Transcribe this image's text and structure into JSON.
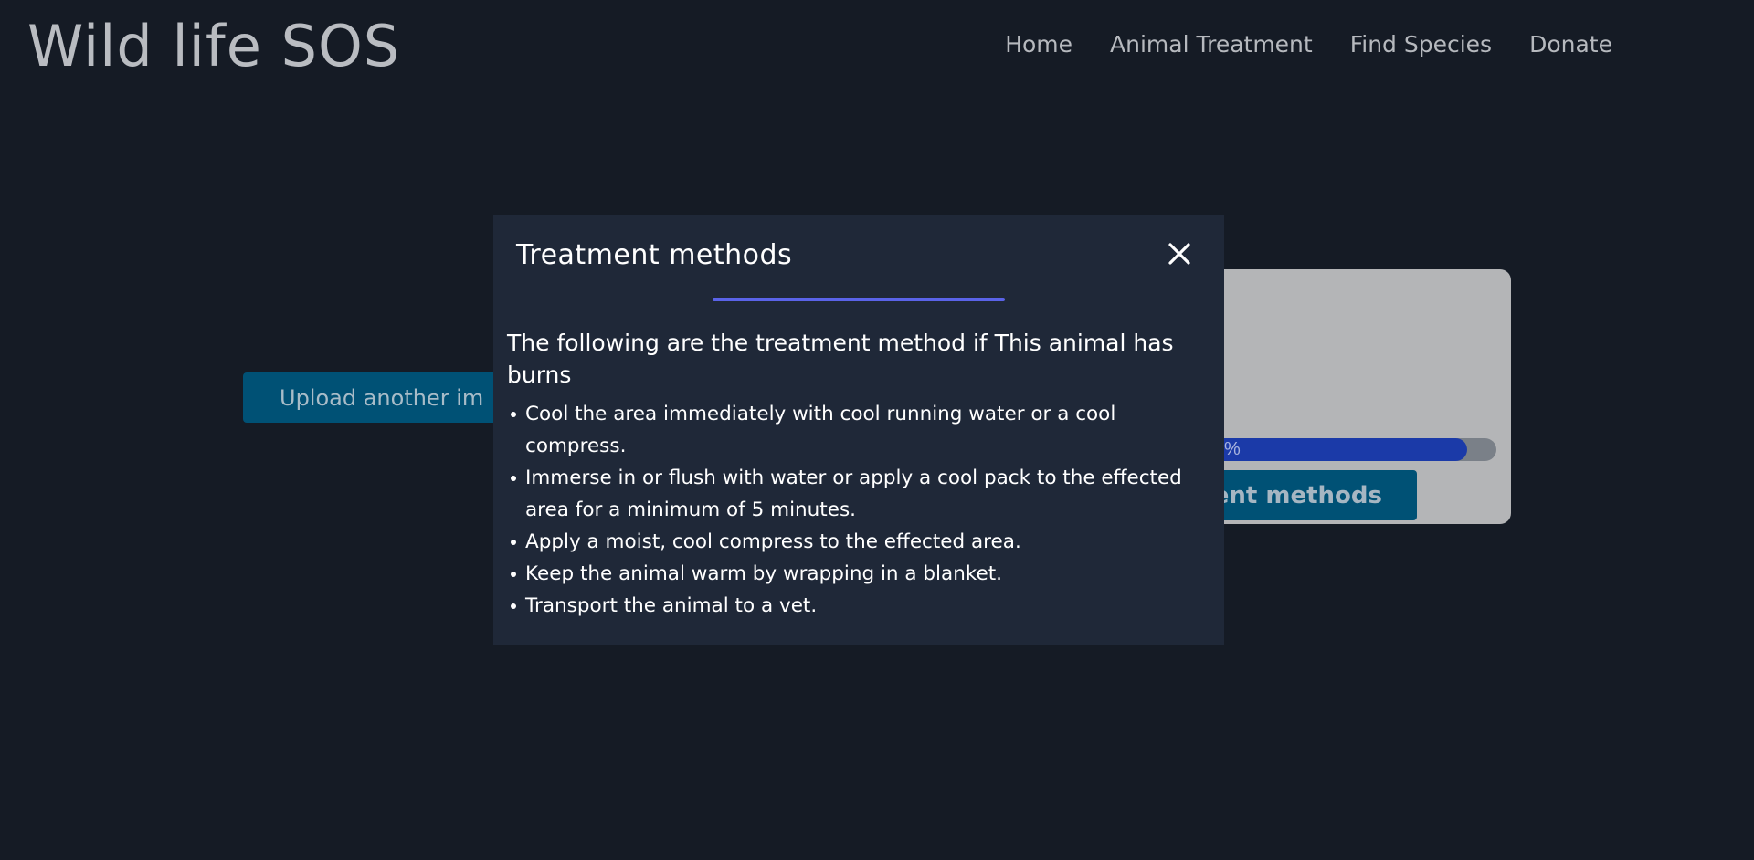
{
  "header": {
    "site_title": "Wild life SOS",
    "nav": [
      {
        "label": "Home"
      },
      {
        "label": "Animal Treatment"
      },
      {
        "label": "Find Species"
      },
      {
        "label": "Donate"
      }
    ]
  },
  "page": {
    "upload_button_label": "Upload another im",
    "progress": {
      "visible_text": "%",
      "value_fraction": 0.9
    },
    "treatment_button_label": "nent methods"
  },
  "modal": {
    "title": "Treatment methods",
    "close_icon": "close-icon",
    "accent_color": "#5a63e8",
    "intro": "The following are the treatment method if This animal has burns",
    "methods": [
      "Cool the area immediately with cool running water or a cool compress.",
      "Immerse in or flush with water or apply a cool pack to the effected area for a minimum of 5 minutes.",
      "Apply a moist, cool compress to the effected area.",
      "Keep the animal warm by wrapping in a blanket.",
      "Transport the animal to a vet."
    ]
  }
}
